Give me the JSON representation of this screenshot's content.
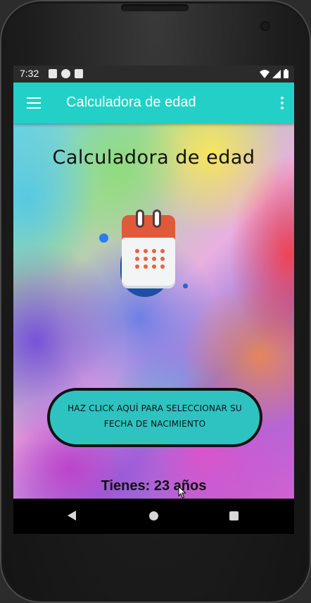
{
  "status_bar": {
    "time": "7:32",
    "icons_left": [
      "notification-a-icon",
      "notification-p-icon",
      "sd-card-icon"
    ],
    "icons_right": [
      "wifi-icon",
      "signal-icon",
      "battery-icon"
    ]
  },
  "app_bar": {
    "title": "Calculadora de edad",
    "menu_icon": "hamburger-menu-icon",
    "overflow_icon": "more-vert-icon",
    "color": "#22d0c8"
  },
  "main": {
    "heading": "Calculadora de edad",
    "calendar_icon": "calendar-icon",
    "select_button_label": "HAZ CLICK AQUÍ PARA SELECCIONAR SU FECHA DE NACIMIENTO",
    "select_button_color": "#2ec3c1",
    "age_result": "Tienes: 23 años"
  },
  "nav_bar": {
    "back_icon": "back-triangle-icon",
    "home_icon": "home-circle-icon",
    "recents_icon": "recents-square-icon"
  }
}
